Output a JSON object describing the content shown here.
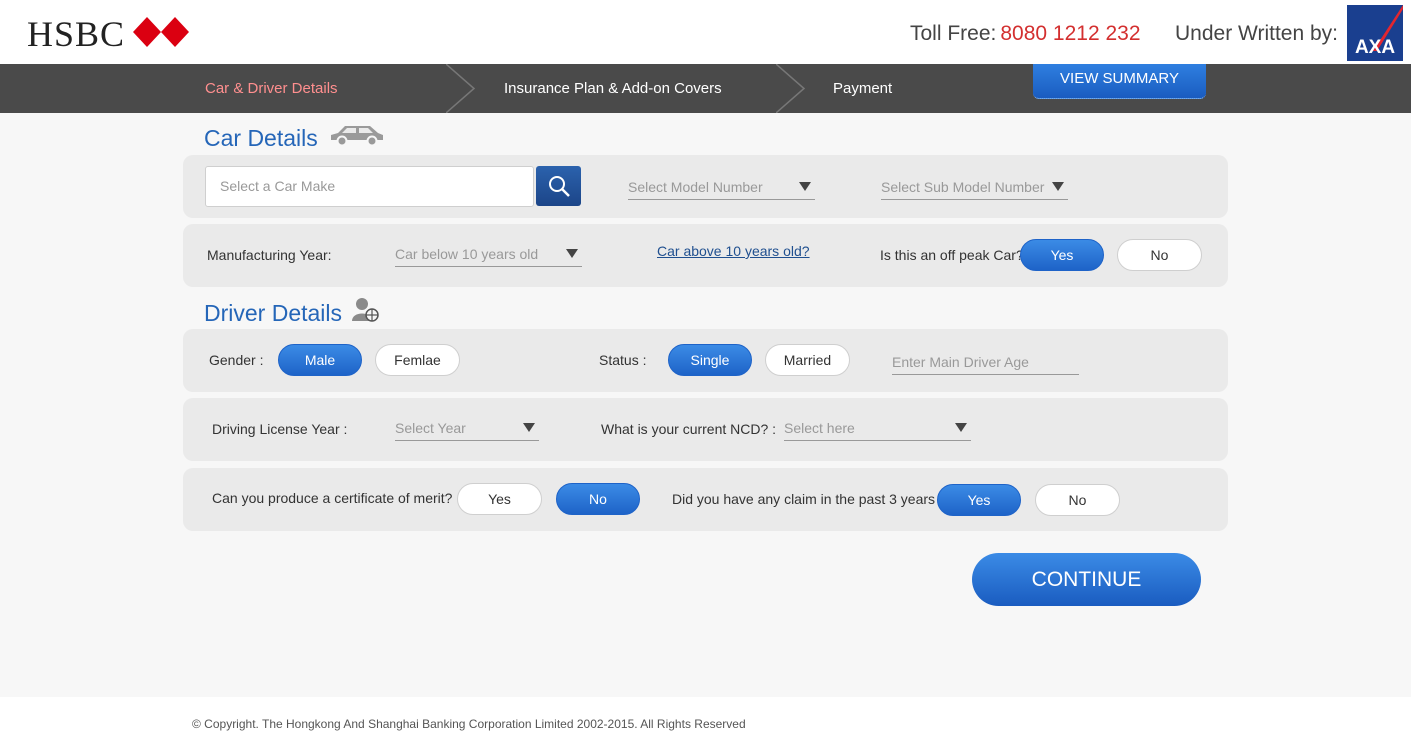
{
  "header": {
    "brand": "HSBC",
    "toll_free_label": "Toll Free:",
    "toll_free_number": "8080 1212 232",
    "underwritten_label": "Under Written by:",
    "insurer_logo": "AXA",
    "brand_color": "#db0011",
    "number_color": "#d32f2f"
  },
  "steps": {
    "items": [
      {
        "label": "Car & Driver Details",
        "active": true
      },
      {
        "label": "Insurance Plan & Add-on Covers",
        "active": false
      },
      {
        "label": "Payment",
        "active": false
      }
    ],
    "view_summary": "VIEW SUMMARY"
  },
  "car_details": {
    "title": "Car Details",
    "icon": "car-icon",
    "car_make_placeholder": "Select a Car Make",
    "search_icon": "search-icon",
    "model_placeholder": "Select Model Number",
    "sub_model_placeholder": "Select Sub Model Number",
    "manufacturing_year_label": "Manufacturing Year:",
    "manufacturing_year_value": "Car below 10 years old",
    "above_10_link": "Car above 10 years old?",
    "off_peak_label": "Is this an off peak Car?",
    "off_peak_yes": "Yes",
    "off_peak_no": "No",
    "off_peak_selected": "Yes"
  },
  "driver_details": {
    "title": "Driver Details",
    "icon": "driver-icon",
    "gender_label": "Gender :",
    "gender_male": "Male",
    "gender_female": "Femlae",
    "gender_selected": "Male",
    "status_label": "Status :",
    "status_single": "Single",
    "status_married": "Married",
    "status_selected": "Single",
    "age_placeholder": "Enter Main Driver Age",
    "license_label": "Driving  License Year :",
    "license_placeholder": "Select Year",
    "ncd_label": "What is your current NCD? :",
    "ncd_placeholder": "Select  here",
    "merit_label": "Can you produce a certificate of merit?",
    "merit_yes": "Yes",
    "merit_no": "No",
    "merit_selected": "No",
    "claim_label": "Did you have any claim in the past 3 years",
    "claim_yes": "Yes",
    "claim_no": "No",
    "claim_selected": "Yes"
  },
  "continue_label": "CONTINUE",
  "footer": {
    "copyright": "© Copyright. The Hongkong And Shanghai Banking Corporation Limited 2002-2015. All Rights Reserved"
  },
  "colors": {
    "accent": "#1e63c8",
    "steps_bar": "#4a4a4a",
    "active_step": "#ff8f8f",
    "section_title": "#2566b8"
  }
}
